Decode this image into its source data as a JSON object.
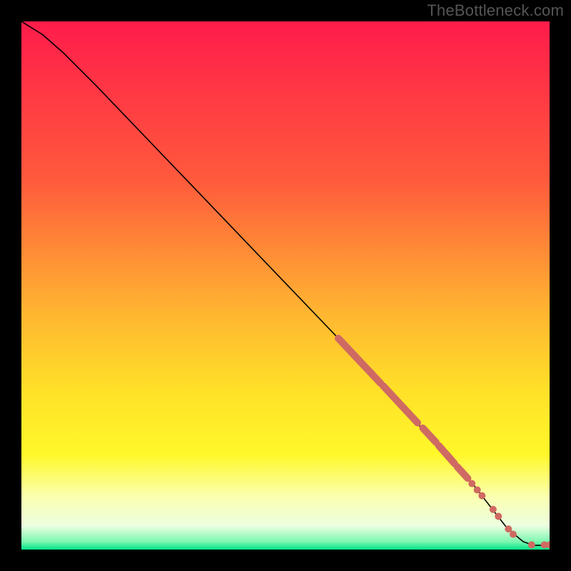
{
  "watermark": "TheBottleneck.com",
  "chart_data": {
    "type": "line",
    "title": "",
    "xlabel": "",
    "ylabel": "",
    "xlim": [
      0,
      100
    ],
    "ylim": [
      0,
      100
    ],
    "gradient_stops": [
      {
        "offset": 0,
        "color": "#ff1c4b"
      },
      {
        "offset": 0.3,
        "color": "#ff5a3c"
      },
      {
        "offset": 0.55,
        "color": "#ffb531"
      },
      {
        "offset": 0.7,
        "color": "#ffe128"
      },
      {
        "offset": 0.82,
        "color": "#fff82a"
      },
      {
        "offset": 0.9,
        "color": "#fbffb0"
      },
      {
        "offset": 0.955,
        "color": "#ecffe0"
      },
      {
        "offset": 0.985,
        "color": "#7cf8b0"
      },
      {
        "offset": 1.0,
        "color": "#00e388"
      }
    ],
    "series": [
      {
        "name": "bottleneck-curve",
        "type": "line",
        "color": "#000000",
        "points": [
          {
            "x": 0,
            "y": 100
          },
          {
            "x": 4,
            "y": 97.5
          },
          {
            "x": 8,
            "y": 94
          },
          {
            "x": 14,
            "y": 88
          },
          {
            "x": 60,
            "y": 40
          },
          {
            "x": 85,
            "y": 13
          },
          {
            "x": 92,
            "y": 4
          },
          {
            "x": 95,
            "y": 1.5
          },
          {
            "x": 97,
            "y": 0.8
          },
          {
            "x": 100,
            "y": 0.8
          }
        ]
      },
      {
        "name": "highlighted-segments",
        "type": "line-bold",
        "color": "#cf6a62",
        "width": 10,
        "segments": [
          [
            {
              "x": 60,
              "y": 40
            },
            {
              "x": 68,
              "y": 31.5
            }
          ],
          [
            {
              "x": 68.5,
              "y": 31
            },
            {
              "x": 75,
              "y": 24
            }
          ],
          [
            {
              "x": 76,
              "y": 23
            },
            {
              "x": 78.5,
              "y": 20.3
            }
          ],
          [
            {
              "x": 79,
              "y": 19.7
            },
            {
              "x": 82,
              "y": 16.3
            }
          ],
          [
            {
              "x": 82.5,
              "y": 15.7
            },
            {
              "x": 84.5,
              "y": 13.5
            }
          ]
        ]
      },
      {
        "name": "highlighted-dots",
        "type": "scatter",
        "color": "#cf6a62",
        "radius": 5,
        "points": [
          {
            "x": 85.3,
            "y": 12.5
          },
          {
            "x": 86.3,
            "y": 11.3
          },
          {
            "x": 87.2,
            "y": 10.2
          },
          {
            "x": 89.3,
            "y": 7.6
          },
          {
            "x": 90.3,
            "y": 6.3
          },
          {
            "x": 92.2,
            "y": 3.9
          },
          {
            "x": 93.1,
            "y": 2.9
          },
          {
            "x": 96.6,
            "y": 0.9
          },
          {
            "x": 99.0,
            "y": 0.9
          },
          {
            "x": 100.0,
            "y": 0.9
          }
        ]
      }
    ]
  }
}
